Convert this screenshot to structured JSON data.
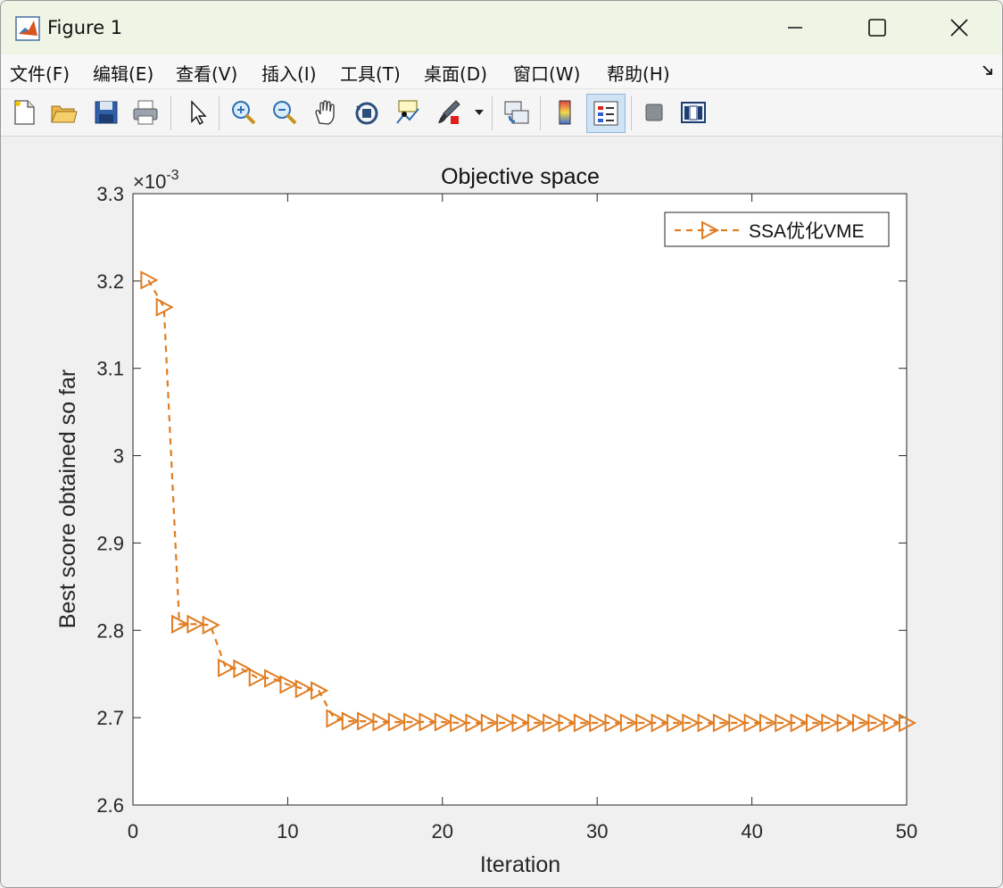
{
  "window": {
    "title": "Figure 1"
  },
  "menu": [
    {
      "label": "文件(F)"
    },
    {
      "label": "编辑(E)"
    },
    {
      "label": "查看(V)"
    },
    {
      "label": "插入(I)"
    },
    {
      "label": "工具(T)"
    },
    {
      "label": "桌面(D)"
    },
    {
      "label": "窗口(W)"
    },
    {
      "label": "帮助(H)"
    }
  ],
  "toolbar": {
    "icons": [
      "new-figure-icon",
      "open-file-icon",
      "save-icon",
      "print-icon",
      "select-arrow-icon",
      "zoom-in-icon",
      "zoom-out-icon",
      "pan-hand-icon",
      "rotate-3d-icon",
      "data-cursor-icon",
      "brush-icon",
      "link-plot-icon",
      "colorbar-icon",
      "legend-icon",
      "hide-plot-tools-icon",
      "show-plot-tools-icon"
    ],
    "active": "legend-icon"
  },
  "chart_data": {
    "type": "line",
    "title": "Objective space",
    "xlabel": "Iteration",
    "ylabel": "Best score obtained so far",
    "exponent_label": "×10",
    "exponent_power": "-3",
    "xlim": [
      0,
      50
    ],
    "ylim": [
      2.6,
      3.3
    ],
    "xticks": [
      "0",
      "10",
      "20",
      "30",
      "40",
      "50"
    ],
    "yticks": [
      "2.6",
      "2.7",
      "2.8",
      "2.9",
      "3",
      "3.1",
      "3.2",
      "3.3"
    ],
    "x": [
      1,
      2,
      3,
      4,
      5,
      6,
      7,
      8,
      9,
      10,
      11,
      12,
      13,
      14,
      15,
      16,
      17,
      18,
      19,
      20,
      21,
      22,
      23,
      24,
      25,
      26,
      27,
      28,
      29,
      30,
      31,
      32,
      33,
      34,
      35,
      36,
      37,
      38,
      39,
      40,
      41,
      42,
      43,
      44,
      45,
      46,
      47,
      48,
      49,
      50
    ],
    "series": [
      {
        "name": "SSA优化VME",
        "color": "#e07d22",
        "line_style": "dashed",
        "marker": "right-triangle",
        "values": [
          3.201,
          3.17,
          2.807,
          2.807,
          2.806,
          2.757,
          2.756,
          2.746,
          2.745,
          2.738,
          2.733,
          2.731,
          2.699,
          2.696,
          2.696,
          2.695,
          2.695,
          2.695,
          2.695,
          2.695,
          2.694,
          2.694,
          2.694,
          2.694,
          2.694,
          2.694,
          2.694,
          2.694,
          2.694,
          2.694,
          2.694,
          2.694,
          2.694,
          2.694,
          2.694,
          2.694,
          2.694,
          2.694,
          2.694,
          2.694,
          2.694,
          2.694,
          2.694,
          2.694,
          2.694,
          2.694,
          2.694,
          2.694,
          2.694,
          2.694
        ]
      }
    ],
    "legend_position": "top-right",
    "grid": false
  }
}
